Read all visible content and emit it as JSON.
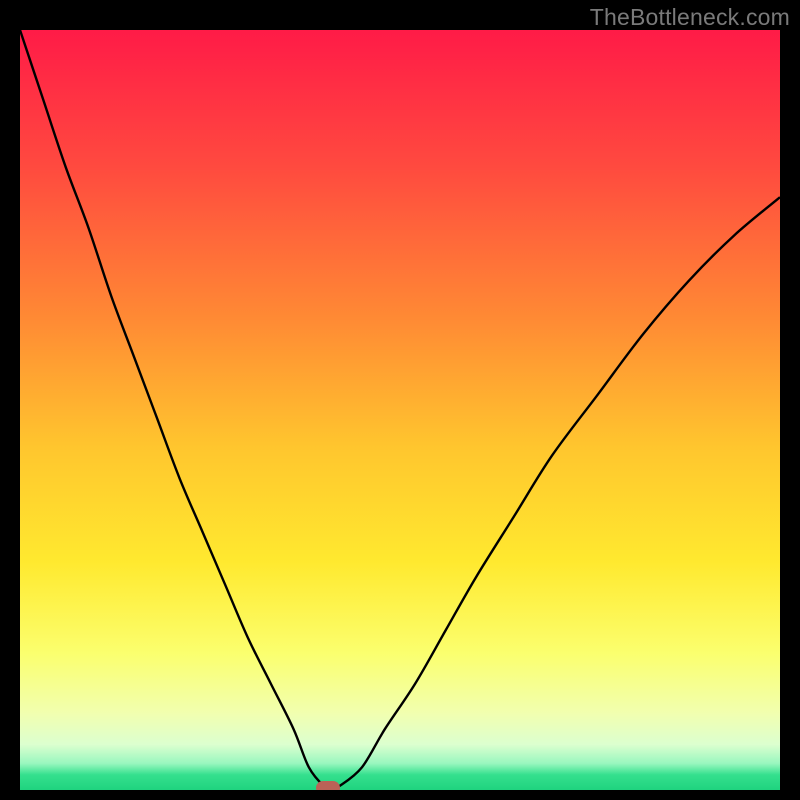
{
  "watermark": "TheBottleneck.com",
  "chart_data": {
    "type": "line",
    "title": "",
    "xlabel": "",
    "ylabel": "",
    "xlim": [
      0,
      100
    ],
    "ylim": [
      0,
      100
    ],
    "grid": false,
    "legend": false,
    "gradient_stops": [
      {
        "pct": 0,
        "color": "#ff1b47"
      },
      {
        "pct": 18,
        "color": "#ff4a3f"
      },
      {
        "pct": 38,
        "color": "#ff8a34"
      },
      {
        "pct": 55,
        "color": "#ffc62e"
      },
      {
        "pct": 70,
        "color": "#ffe92f"
      },
      {
        "pct": 82,
        "color": "#fbff6e"
      },
      {
        "pct": 90,
        "color": "#f1ffb0"
      },
      {
        "pct": 94,
        "color": "#dcffcf"
      },
      {
        "pct": 96.5,
        "color": "#99f7bf"
      },
      {
        "pct": 98,
        "color": "#35e08e"
      },
      {
        "pct": 100,
        "color": "#1fd37f"
      }
    ],
    "series": [
      {
        "name": "bottleneck-curve",
        "x": [
          0,
          3,
          6,
          9,
          12,
          15,
          18,
          21,
          24,
          27,
          30,
          33,
          36,
          38,
          40,
          41,
          42,
          45,
          48,
          52,
          56,
          60,
          65,
          70,
          76,
          82,
          88,
          94,
          100
        ],
        "y": [
          100,
          91,
          82,
          74,
          65,
          57,
          49,
          41,
          34,
          27,
          20,
          14,
          8,
          3,
          0.5,
          0.2,
          0.5,
          3,
          8,
          14,
          21,
          28,
          36,
          44,
          52,
          60,
          67,
          73,
          78
        ]
      }
    ],
    "marker": {
      "x": 40.5,
      "y": 0.3,
      "color": "#bb6257"
    }
  }
}
